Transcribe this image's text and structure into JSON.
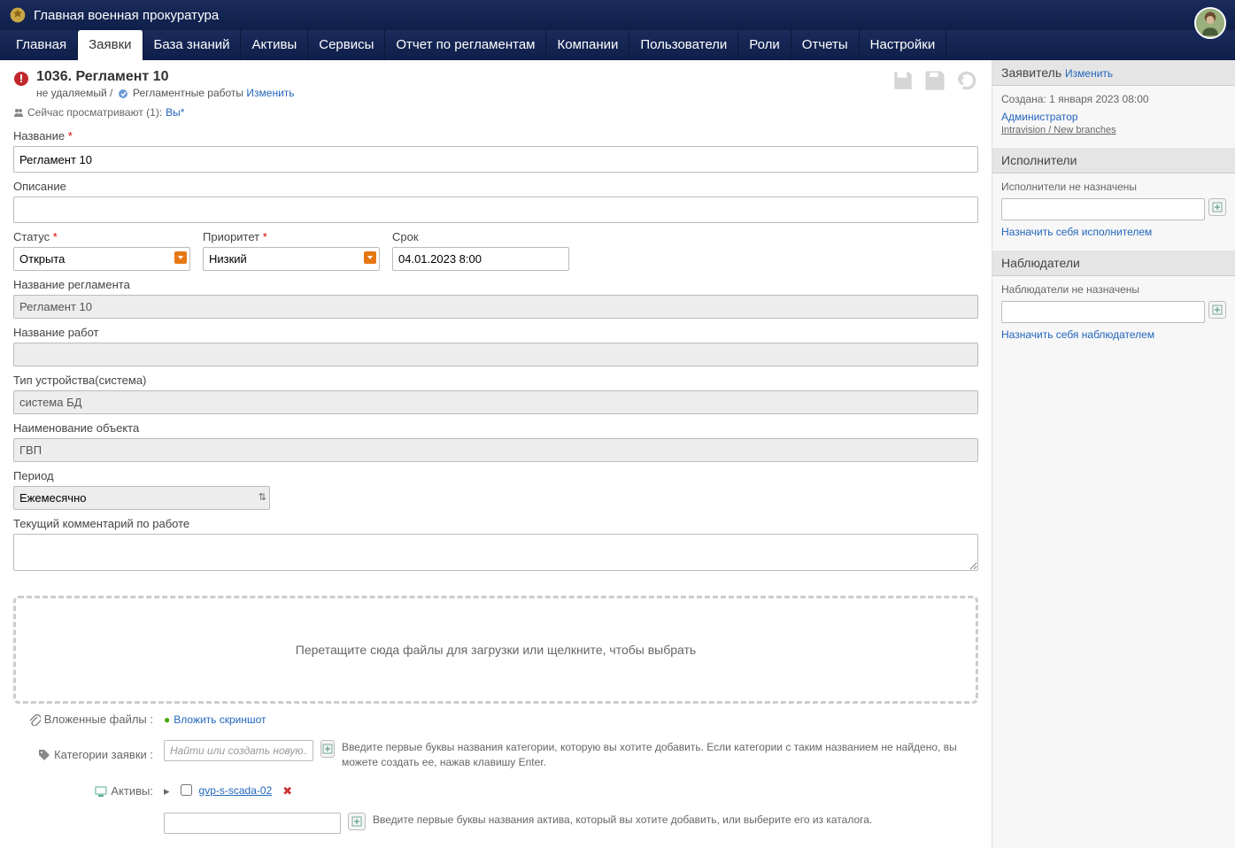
{
  "header": {
    "title": "Главная военная прокуратура"
  },
  "nav": {
    "items": [
      "Главная",
      "Заявки",
      "База знаний",
      "Активы",
      "Сервисы",
      "Отчет по регламентам",
      "Компании",
      "Пользователи",
      "Роли",
      "Отчеты",
      "Настройки"
    ],
    "activeIndex": 1
  },
  "ticket": {
    "title": "1036. Регламент 10",
    "nonDeletable": "не удаляемый",
    "sep": "/",
    "workType": "Регламентные работы",
    "changeLink": "Изменить"
  },
  "viewers": {
    "label": "Сейчас просматривают (1):",
    "you": "Вы*"
  },
  "form": {
    "nameLabel": "Название",
    "nameValue": "Регламент 10",
    "descLabel": "Описание",
    "descValue": "",
    "statusLabel": "Статус",
    "statusValue": "Открыта",
    "priorityLabel": "Приоритет",
    "priorityValue": "Низкий",
    "deadlineLabel": "Срок",
    "deadlineValue": "04.01.2023 8:00",
    "regNameLabel": "Название регламента",
    "regNameValue": "Регламент 10",
    "workNameLabel": "Название работ",
    "workNameValue": "",
    "deviceTypeLabel": "Тип устройства(система)",
    "deviceTypeValue": "система БД",
    "objectNameLabel": "Наименование объекта",
    "objectNameValue": "ГВП",
    "periodLabel": "Период",
    "periodValue": "Ежемесячно",
    "commentLabel": "Текущий комментарий по работе",
    "commentValue": ""
  },
  "dropzone": {
    "text": "Перетащите сюда файлы для загрузки или щелкните, чтобы выбрать"
  },
  "attachments": {
    "label": "Вложенные файлы :",
    "screenshotLink": "Вложить скриншот"
  },
  "categories": {
    "label": "Категории заявки :",
    "placeholder": "Найти или создать новую...",
    "hint": "Введите первые буквы названия категории, которую вы хотите добавить. Если категории с таким названием не найдено, вы можете создать ее, нажав клавишу Enter."
  },
  "assets": {
    "label": "Активы:",
    "item": "gvp-s-scada-02",
    "hint": "Введите первые буквы названия актива, который вы хотите добавить, или выберите его из каталога."
  },
  "sidebar": {
    "requester": {
      "title": "Заявитель",
      "changeLink": "Изменить",
      "created": "Создана: 1 января 2023 08:00",
      "user": "Администратор",
      "org": "Intravision / New branches"
    },
    "executors": {
      "title": "Исполнители",
      "empty": "Исполнители не назначены",
      "assignSelf": "Назначить себя исполнителем"
    },
    "watchers": {
      "title": "Наблюдатели",
      "empty": "Наблюдатели не назначены",
      "assignSelf": "Назначить себя наблюдателем"
    }
  }
}
